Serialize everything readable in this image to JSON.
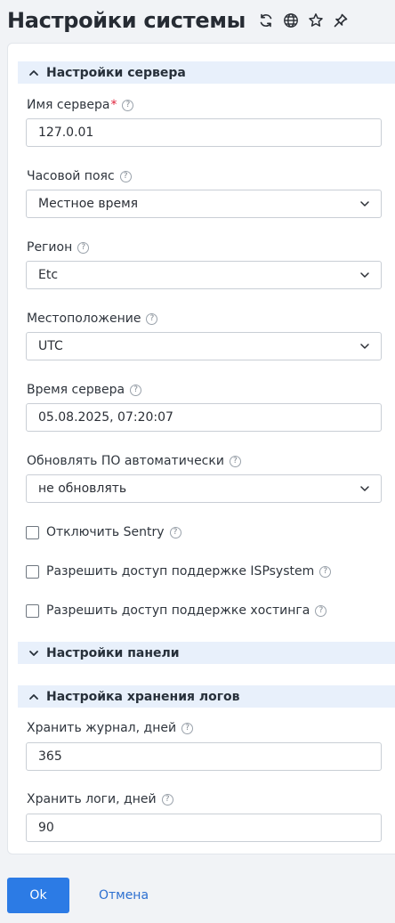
{
  "header": {
    "title": "Настройки системы",
    "icons": [
      "refresh-icon",
      "globe-icon",
      "star-icon",
      "pin-icon"
    ]
  },
  "sections": {
    "server": {
      "label": "Настройки сервера",
      "expanded": true
    },
    "panel": {
      "label": "Настройки панели",
      "expanded": false
    },
    "logs": {
      "label": "Настройка хранения логов",
      "expanded": true
    }
  },
  "fields": {
    "server_name": {
      "label": "Имя сервера",
      "required_mark": "*",
      "value": "127.0.01"
    },
    "timezone": {
      "label": "Часовой пояс",
      "value": "Местное время"
    },
    "region": {
      "label": "Регион",
      "value": "Etc"
    },
    "location": {
      "label": "Местоположение",
      "value": "UTC"
    },
    "server_time": {
      "label": "Время сервера",
      "value": "05.08.2025, 07:20:07"
    },
    "auto_update": {
      "label": "Обновлять ПО автоматически",
      "value": "не обновлять"
    },
    "journal_days": {
      "label": "Хранить журнал, дней",
      "value": "365"
    },
    "logs_days": {
      "label": "Хранить логи, дней",
      "value": "90"
    }
  },
  "checkboxes": {
    "sentry": {
      "label": "Отключить Sentry",
      "checked": false
    },
    "isp_support": {
      "label": "Разрешить доступ поддержке ISPsystem",
      "checked": false
    },
    "hosting_support": {
      "label": "Разрешить доступ поддержке хостинга",
      "checked": false
    }
  },
  "help_glyph": "?",
  "buttons": {
    "ok": "Ok",
    "cancel": "Отмена"
  },
  "colors": {
    "accent": "#2c7be5",
    "section_bg": "#e8f0fb",
    "required": "#e0233b"
  }
}
